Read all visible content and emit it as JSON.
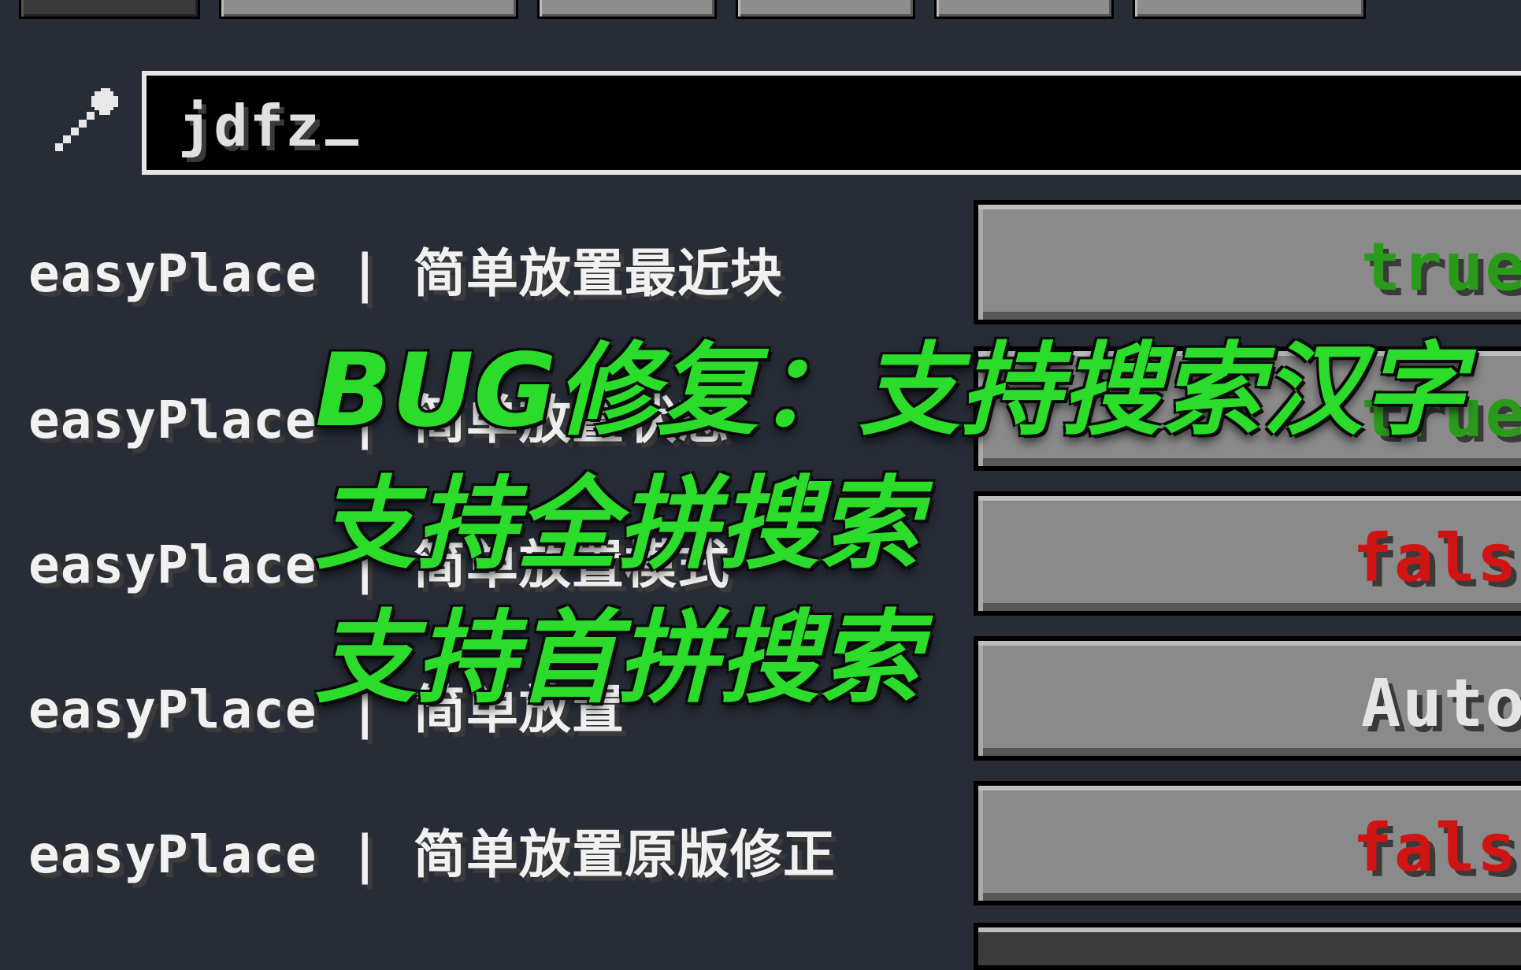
{
  "search": {
    "value": "jdfz"
  },
  "rows": [
    {
      "label": "easyPlace | 简单放置最近块",
      "value": "true"
    },
    {
      "label": "easyPlace | 简单放置状态",
      "value": "true"
    },
    {
      "label": "easyPlace | 简单放置模式",
      "value": "false"
    },
    {
      "label": "easyPlace | 简单放置",
      "value": "Auto"
    },
    {
      "label": "easyPlace | 简单放置原版修正",
      "value": "false"
    }
  ],
  "overlay": {
    "line1": "BUG修复：支持搜索汉字",
    "line2": "支持全拼搜索",
    "line3": "支持首拼搜索"
  },
  "colors": {
    "true": "#2a9a1a",
    "false": "#d01414",
    "neutral": "#e4e4e4",
    "overlay_text": "#2bdc2b",
    "background": "#272c37"
  },
  "icons": {
    "search": "magnifier-icon"
  }
}
